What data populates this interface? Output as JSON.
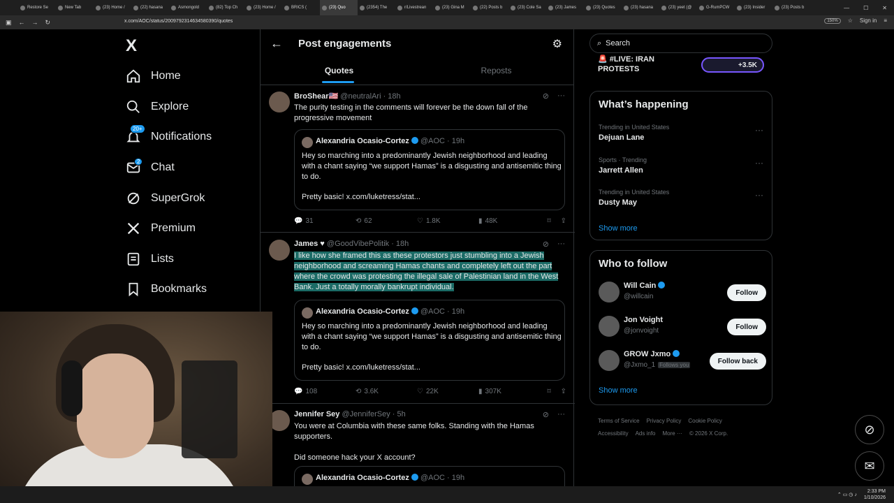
{
  "browser": {
    "tabs": [
      "Restore Se",
      "New Tab",
      "(23) Home /",
      "(22) hasana",
      "Asmongold",
      "(82) Top Ch",
      "(23) Home /",
      "BRICS (",
      "(23) Quo",
      "(2354) The",
      "r/Livestrean",
      "(23) Gina M",
      "(22) Posts b",
      "(23) Cole Sa",
      "(23) James",
      "(23) Quotes",
      "(23) hasana",
      "(23) yeet (@",
      "G-RumPCW",
      "(23) Insider",
      "(23) Posts b"
    ],
    "active_tab_index": 8,
    "url": "x.com/AOC/status/2009792314634580390/quotes",
    "zoom": "150%",
    "sign_in": "Sign in"
  },
  "leftnav": {
    "logo": "X",
    "items": [
      {
        "label": "Home",
        "icon": "home-icon"
      },
      {
        "label": "Explore",
        "icon": "search-icon"
      },
      {
        "label": "Notifications",
        "icon": "bell-icon",
        "badge": "20+"
      },
      {
        "label": "Chat",
        "icon": "mail-icon",
        "badge": "2"
      },
      {
        "label": "SuperGrok",
        "icon": "grok-icon"
      },
      {
        "label": "Premium",
        "icon": "x-icon"
      },
      {
        "label": "Lists",
        "icon": "list-icon"
      },
      {
        "label": "Bookmarks",
        "icon": "bookmark-icon"
      }
    ]
  },
  "center": {
    "title": "Post engagements",
    "tabs": [
      "Quotes",
      "Reposts"
    ],
    "posts": [
      {
        "name": "BroShear🇺🇸",
        "handle": "@neutralAri · 18h",
        "text": "The purity testing in the comments will forever be the down fall of the progressive movement",
        "quote_name": "Alexandria Ocasio-Cortez",
        "quote_handle": "@AOC · 19h",
        "quote_text": "Hey so marching into a predominantly Jewish neighborhood and leading with a chant saying “we support Hamas” is a disgusting and antisemitic thing to do.",
        "quote_text2": "Pretty basic! x.com/luketress/stat...",
        "replies": "31",
        "reposts": "62",
        "likes": "1.8K",
        "views": "48K"
      },
      {
        "name": "James ♥",
        "handle": "@GoodVibePolitik · 18h",
        "text": "I like how she framed this as these protestors just stumbling into a Jewish neighborhood and screaming Hamas chants and completely left out the part where the crowd was protesting the illegal sale of Palestinian land in the West Bank. Just a totally morally bankrupt individual.",
        "quote_name": "Alexandria Ocasio-Cortez",
        "quote_handle": "@AOC · 19h",
        "quote_text": "Hey so marching into a predominantly Jewish neighborhood and leading with a chant saying “we support Hamas” is a disgusting and antisemitic thing to do.",
        "quote_text2": "Pretty basic! x.com/luketress/stat...",
        "replies": "108",
        "reposts": "3.6K",
        "likes": "22K",
        "views": "307K"
      },
      {
        "name": "Jennifer Sey",
        "handle": "@JenniferSey · 5h",
        "text": "You were at Columbia with these same folks. Standing with the Hamas supporters.",
        "text2": "Did someone hack your X account?",
        "quote_name": "Alexandria Ocasio-Cortez",
        "quote_handle": "@AOC · 19h"
      }
    ]
  },
  "right": {
    "search_placeholder": "Search",
    "live": "🚨 #LIVE: IRAN PROTESTS",
    "live_count": "+3.5K",
    "happening_title": "What’s happening",
    "trends": [
      {
        "context": "Trending in United States",
        "name": "Dejuan Lane"
      },
      {
        "context": "Sports · Trending",
        "name": "Jarrett Allen"
      },
      {
        "context": "Trending in United States",
        "name": "Dusty May"
      }
    ],
    "show_more": "Show more",
    "wtf_title": "Who to follow",
    "follow": [
      {
        "name": "Will Cain",
        "handle": "@willcain",
        "button": "Follow"
      },
      {
        "name": "Jon Voight",
        "handle": "@jonvoight",
        "button": "Follow"
      },
      {
        "name": "GROW Jxmo",
        "handle": "@Jxmo_1",
        "follows_you": "Follows you",
        "button": "Follow back"
      }
    ],
    "footer": [
      "Terms of Service",
      "Privacy Policy",
      "Cookie Policy",
      "Accessibility",
      "Ads info",
      "More ···",
      "© 2026 X Corp."
    ]
  },
  "taskbar": {
    "time": "2:33 PM",
    "date": "1/10/2026"
  }
}
